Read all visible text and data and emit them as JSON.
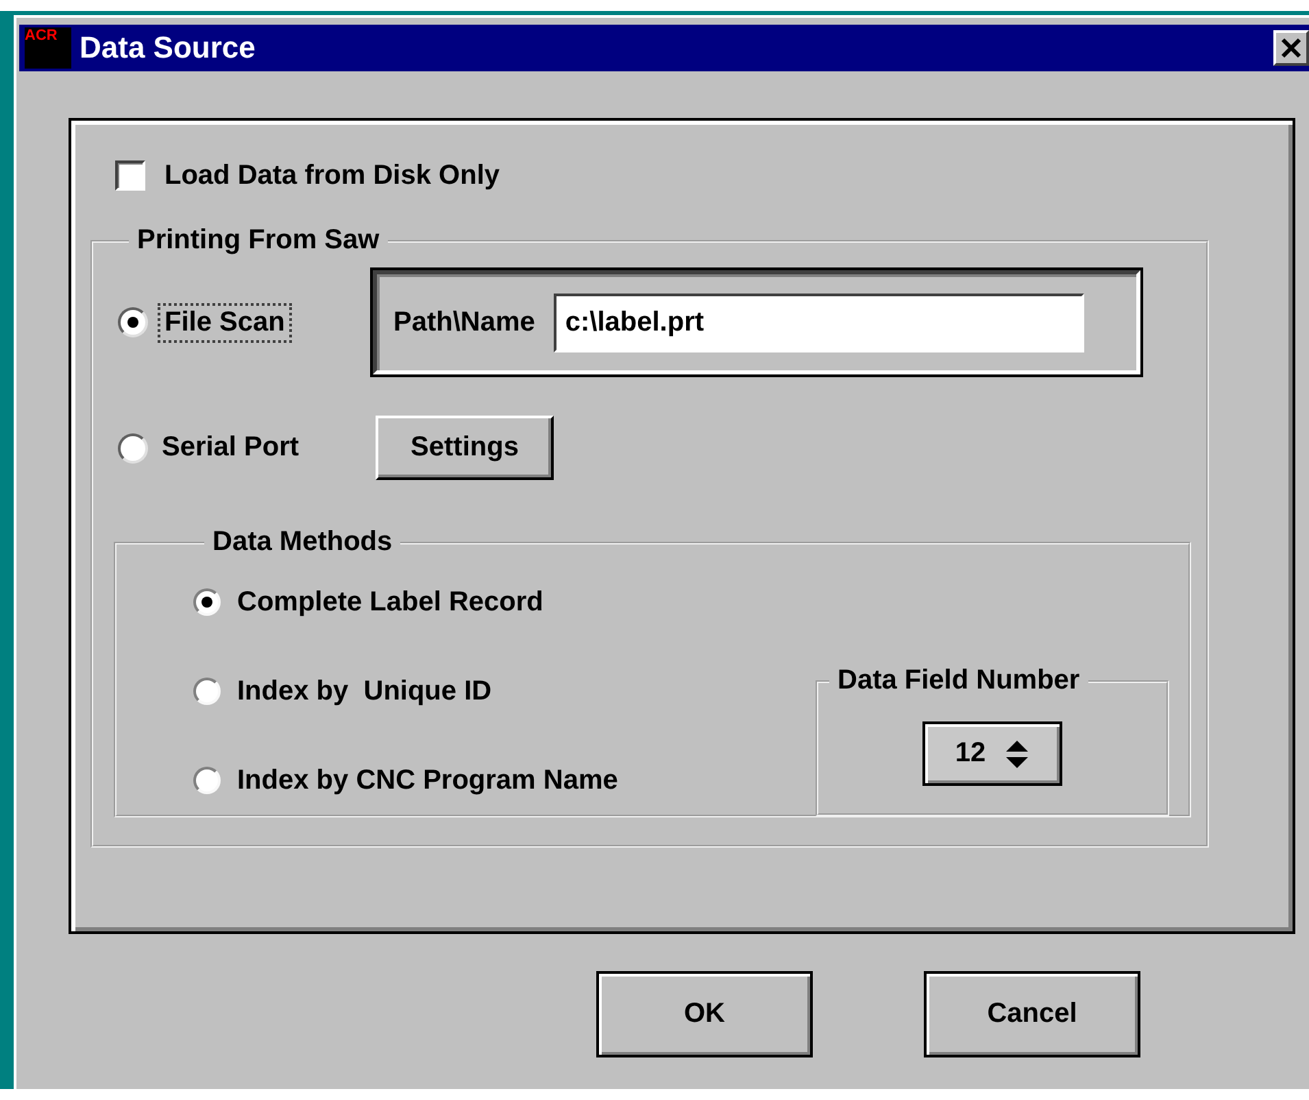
{
  "window": {
    "app_icon_text": "ACR",
    "title": "Data Source"
  },
  "load_from_disk": {
    "label": "Load Data from Disk Only",
    "checked": false
  },
  "printing_group": {
    "title": "Printing From Saw",
    "sources": [
      {
        "label": "File Scan",
        "selected": true,
        "focused": true
      },
      {
        "label": "Serial Port",
        "selected": false,
        "focused": false
      }
    ],
    "path_field": {
      "label": "Path\\Name",
      "value": "c:\\label.prt"
    },
    "settings_button": "Settings"
  },
  "data_methods": {
    "title": "Data Methods",
    "options": [
      {
        "label": "Complete Label Record",
        "selected": true
      },
      {
        "label": "Index by  Unique ID",
        "selected": false
      },
      {
        "label": "Index by CNC Program Name",
        "selected": false
      }
    ]
  },
  "data_field_number": {
    "title": "Data Field Number",
    "value": "12"
  },
  "buttons": [
    "OK",
    "Cancel"
  ]
}
